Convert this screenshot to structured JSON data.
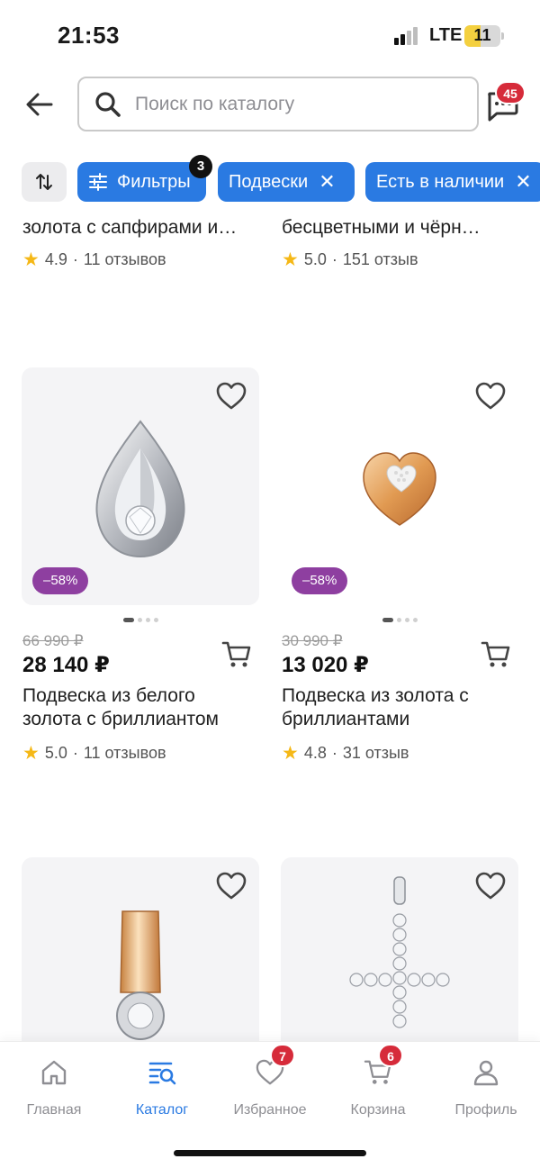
{
  "status_bar": {
    "time": "21:53",
    "network": "LTE",
    "battery": "11",
    "battery_level": 0.11
  },
  "header": {
    "search_placeholder": "Поиск по каталогу",
    "chat_badge": "45"
  },
  "filters": {
    "filters_label": "Фильтры",
    "filters_count": "3",
    "chips": [
      {
        "label": "Подвески"
      },
      {
        "label": "Есть в наличии"
      }
    ]
  },
  "top_row": [
    {
      "title": "золота с сапфирами и…",
      "rating": "4.9",
      "reviews": "11 отзывов"
    },
    {
      "title": "бесцветными и чёрн…",
      "rating": "5.0",
      "reviews": "151 отзыв"
    }
  ],
  "products": [
    {
      "discount": "–58%",
      "old_price": "66 990 ₽",
      "price": "28 140 ₽",
      "title_line1": "Подвеска из белого",
      "title_line2": "золота с бриллиантом",
      "rating": "5.0",
      "reviews": "11 отзывов"
    },
    {
      "discount": "–58%",
      "old_price": "30 990 ₽",
      "price": "13 020 ₽",
      "title_line1": "Подвеска из золота с",
      "title_line2": "бриллиантами",
      "rating": "4.8",
      "reviews": "31 отзыв"
    }
  ],
  "bottom_nav": {
    "items": [
      {
        "label": "Главная",
        "icon": "home-icon"
      },
      {
        "label": "Каталог",
        "icon": "catalog-icon",
        "active": true
      },
      {
        "label": "Избранное",
        "icon": "heart-icon",
        "badge": "7"
      },
      {
        "label": "Корзина",
        "icon": "cart-icon",
        "badge": "6"
      },
      {
        "label": "Профиль",
        "icon": "profile-icon"
      }
    ]
  },
  "colors": {
    "accent": "#2a7ae2",
    "badge": "#d62b3a",
    "discount": "#8e3fa0",
    "star": "#f5b817"
  }
}
